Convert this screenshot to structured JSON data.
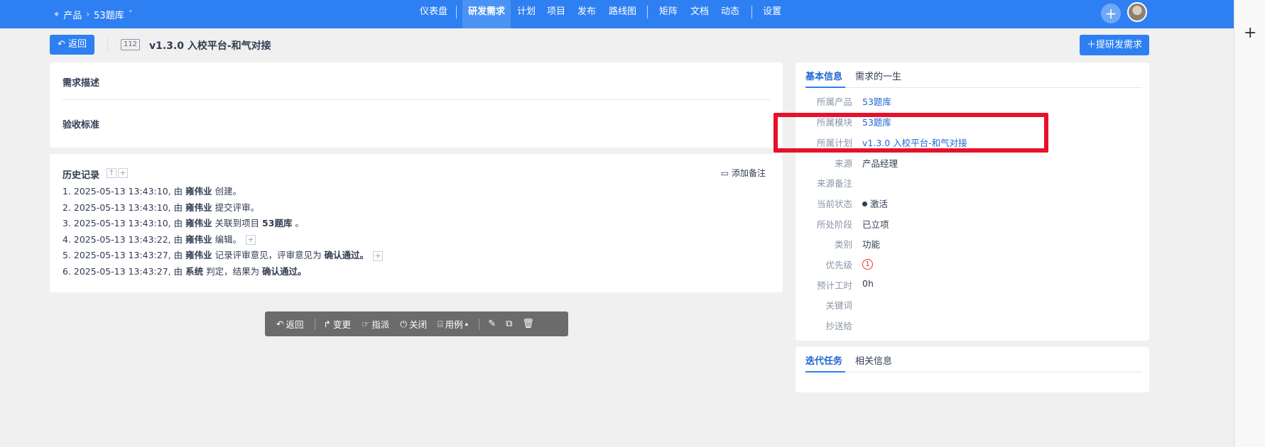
{
  "topbar": {
    "breadcrumb": {
      "product_label": "产品",
      "project_label": "53题库"
    },
    "nav": [
      "仪表盘",
      "研发需求",
      "计划",
      "项目",
      "发布",
      "路线图",
      "矩阵",
      "文档",
      "动态",
      "设置"
    ],
    "active_nav": "研发需求",
    "create_symbol": "+"
  },
  "header": {
    "back_label": "返回",
    "story_id": "112",
    "story_title": "v1.3.0 入校平台-和气对接",
    "add_story_label": "提研发需求"
  },
  "description": {
    "desc_title": "需求描述",
    "acceptance_title": "验收标准"
  },
  "history": {
    "title": "历史记录",
    "add_note_label": "添加备注",
    "items": [
      {
        "prefix": "1. 2025-05-13 13:43:10, 由 ",
        "actor": "雍伟业",
        "action": " 创建。",
        "target": "",
        "suffix": ""
      },
      {
        "prefix": "2. 2025-05-13 13:43:10, 由 ",
        "actor": "雍伟业",
        "action": " 提交评审。",
        "target": "",
        "suffix": ""
      },
      {
        "prefix": "3. 2025-05-13 13:43:10, 由 ",
        "actor": "雍伟业",
        "action": " 关联到项目 ",
        "target": "53题库",
        "suffix": " 。"
      },
      {
        "prefix": "4. 2025-05-13 13:43:22, 由 ",
        "actor": "雍伟业",
        "action": " 编辑。",
        "target": "",
        "suffix": ""
      },
      {
        "prefix": "5. 2025-05-13 13:43:27, 由 ",
        "actor": "雍伟业",
        "action": " 记录评审意见，评审意见为 ",
        "target": "确认通过。",
        "suffix": ""
      },
      {
        "prefix": "6. 2025-05-13 13:43:27, 由 ",
        "actor": "系统",
        "action": " 判定，结果为 ",
        "target": "确认通过。",
        "suffix": ""
      }
    ]
  },
  "toolbar": {
    "back": "返回",
    "change": "变更",
    "assign": "指派",
    "close": "关闭",
    "testcase": "用例"
  },
  "info": {
    "tabs": [
      "基本信息",
      "需求的一生"
    ],
    "rows": [
      {
        "label": "所属产品",
        "value": "53题库",
        "link": true
      },
      {
        "label": "所属模块",
        "value": "53题库",
        "link": true
      },
      {
        "label": "所属计划",
        "value": "v1.3.0 入校平台-和气对接",
        "link": true
      },
      {
        "label": "来源",
        "value": "产品经理"
      },
      {
        "label": "来源备注",
        "value": ""
      },
      {
        "label": "当前状态",
        "value": "激活"
      },
      {
        "label": "所处阶段",
        "value": "已立项"
      },
      {
        "label": "类别",
        "value": "功能"
      },
      {
        "label": "优先级",
        "value": "1"
      },
      {
        "label": "预计工时",
        "value": "0h"
      },
      {
        "label": "关键词",
        "value": ""
      },
      {
        "label": "抄送给",
        "value": ""
      }
    ]
  },
  "iteration": {
    "tabs": [
      "迭代任务",
      "相关信息"
    ]
  },
  "colors": {
    "primary": "#2e7ff2",
    "link": "#1e66d4",
    "highlight": "#e8102a",
    "priority": "#e53333"
  }
}
